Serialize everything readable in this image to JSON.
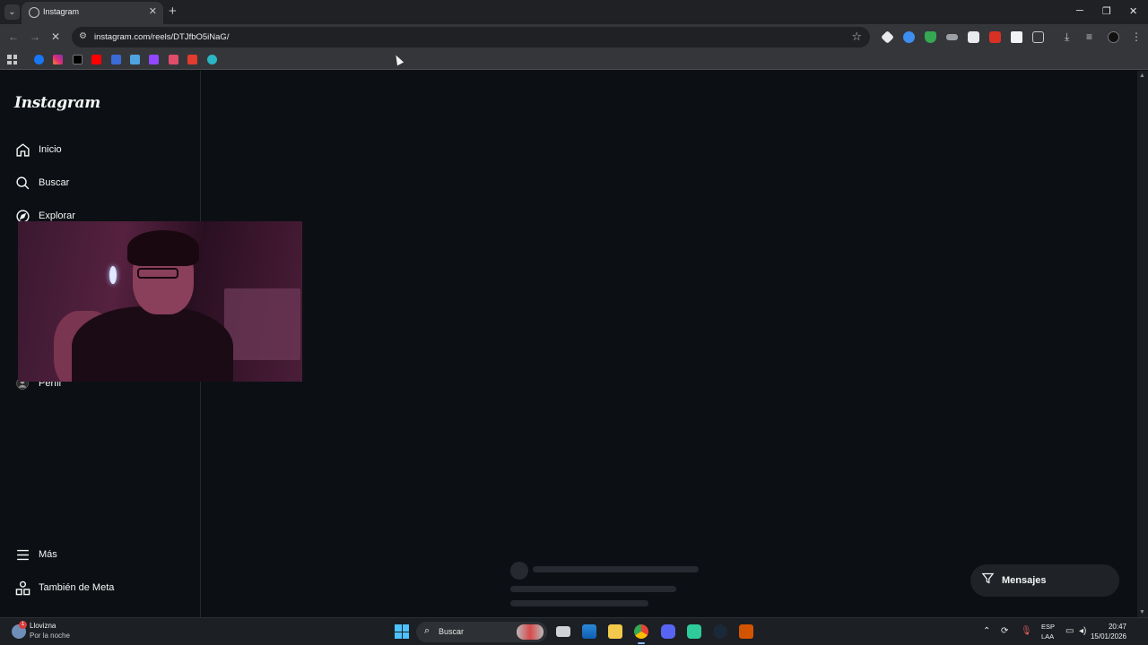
{
  "browser": {
    "tab_title": "Instagram",
    "url": "instagram.com/reels/DTJfbO5iNaG/",
    "window_controls": {
      "minimize": "─",
      "restore": "❐",
      "close": "✕"
    }
  },
  "instagram": {
    "logo": "Instagram",
    "nav": {
      "home": "Inicio",
      "search": "Buscar",
      "explore": "Explorar",
      "profile": "Perfil",
      "more": "Más",
      "meta": "También de Meta"
    },
    "messages_label": "Mensajes"
  },
  "taskbar": {
    "weather_title": "Llovizna",
    "weather_sub": "Por la noche",
    "weather_badge": "1",
    "search_label": "Buscar",
    "lang_top": "ESP",
    "lang_bottom": "LAA",
    "time": "20:47",
    "date": "15/01/2026"
  },
  "colors": {
    "background": "#0c1014",
    "chrome_dark": "#202124",
    "chrome_toolbar": "#35363a",
    "accent": "#4cc2ff"
  }
}
